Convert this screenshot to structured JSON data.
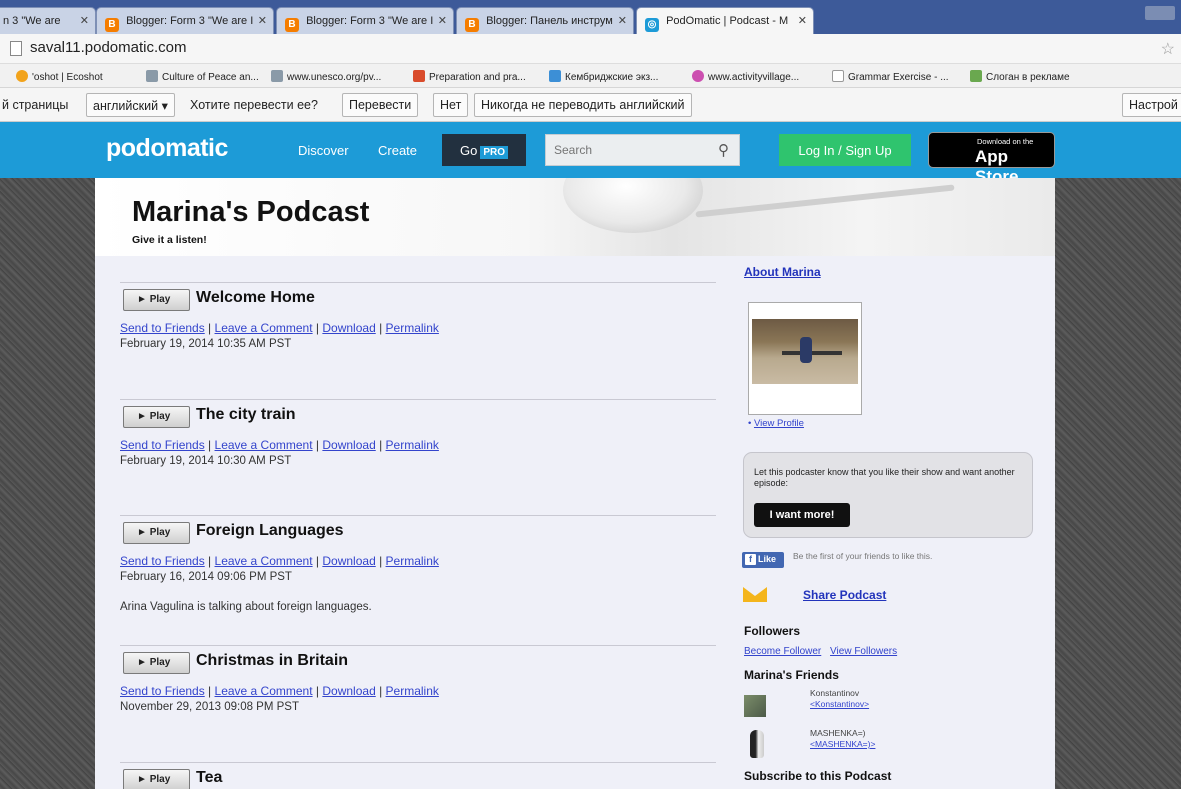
{
  "browser": {
    "tabs": [
      {
        "label": "n 3 \"We are",
        "favicon": "page-icon"
      },
      {
        "label": "Blogger: Form 3 \"We are I",
        "favicon": "blogger-icon"
      },
      {
        "label": "Blogger: Form 3 \"We are I",
        "favicon": "blogger-icon"
      },
      {
        "label": "Blogger: Панель инструм",
        "favicon": "blogger-icon"
      },
      {
        "label": "PodOmatic | Podcast - M",
        "favicon": "podomatic-icon",
        "active": true
      }
    ],
    "url": "saval11.podomatic.com",
    "bookmarks": [
      "'oshot | Ecoshot",
      "Culture of Peace an...",
      "www.unesco.org/pv...",
      "Preparation and pra...",
      "Кембриджские экз...",
      "www.activityvillage...",
      "Grammar Exercise - ...",
      "Слоган в рекламе"
    ],
    "translate_bar": {
      "prefix": "й страницы",
      "language": "английский",
      "question": "Хотите перевести ее?",
      "translate_btn": "Перевести",
      "no_btn": "Нет",
      "never_btn": "Никогда не переводить английский",
      "settings_btn": "Настрой"
    }
  },
  "header": {
    "logo": "podomatic",
    "nav_discover": "Discover",
    "nav_create": "Create",
    "go_label": "Go",
    "pro_badge": "PRO",
    "search_placeholder": "Search",
    "login": "Log In / Sign Up",
    "appstore_small": "Download on the",
    "appstore_big": "App Store"
  },
  "podcast": {
    "title": "Marina's Podcast",
    "subtitle": "Give it a listen!"
  },
  "episodes": [
    {
      "play": "Play",
      "title": "Welcome Home",
      "date": "February 19, 2014 10:35 AM PST",
      "description": ""
    },
    {
      "play": "Play",
      "title": "The city train",
      "date": "February 19, 2014 10:30 AM PST",
      "description": ""
    },
    {
      "play": "Play",
      "title": "Foreign Languages",
      "date": "February 16, 2014 09:06 PM PST",
      "description": "Arina Vagulina is talking about foreign languages."
    },
    {
      "play": "Play",
      "title": "Christmas in Britain",
      "date": "November 29, 2013 09:08 PM PST",
      "description": ""
    },
    {
      "play": "Play",
      "title": "Tea",
      "date": "",
      "description": ""
    }
  ],
  "episode_links": {
    "send": "Send to Friends",
    "comment": "Leave a Comment",
    "download": "Download",
    "permalink": "Permalink",
    "sep": " | "
  },
  "sidebar": {
    "about": "About Marina",
    "view_profile": "View Profile",
    "wantmore_text": "Let this podcaster know that you like their show and want another episode:",
    "wantmore_btn": "I want more!",
    "fb_like": "Like",
    "fb_text": "Be the first of your friends to like this.",
    "share": "Share Podcast",
    "followers_heading": "Followers",
    "become_follower": "Become Follower",
    "view_followers": "View Followers",
    "friends_heading": "Marina's Friends",
    "friends": [
      {
        "name": "Konstantinov",
        "link": "<Konstantinov>"
      },
      {
        "name": "MASHENKA=)",
        "link": "<MASHENKA=)>"
      }
    ],
    "subscribe": "Subscribe to this Podcast"
  },
  "colors": {
    "header_blue": "#1d9bd7",
    "login_green": "#2fc46e",
    "link_blue": "#3344cc"
  }
}
